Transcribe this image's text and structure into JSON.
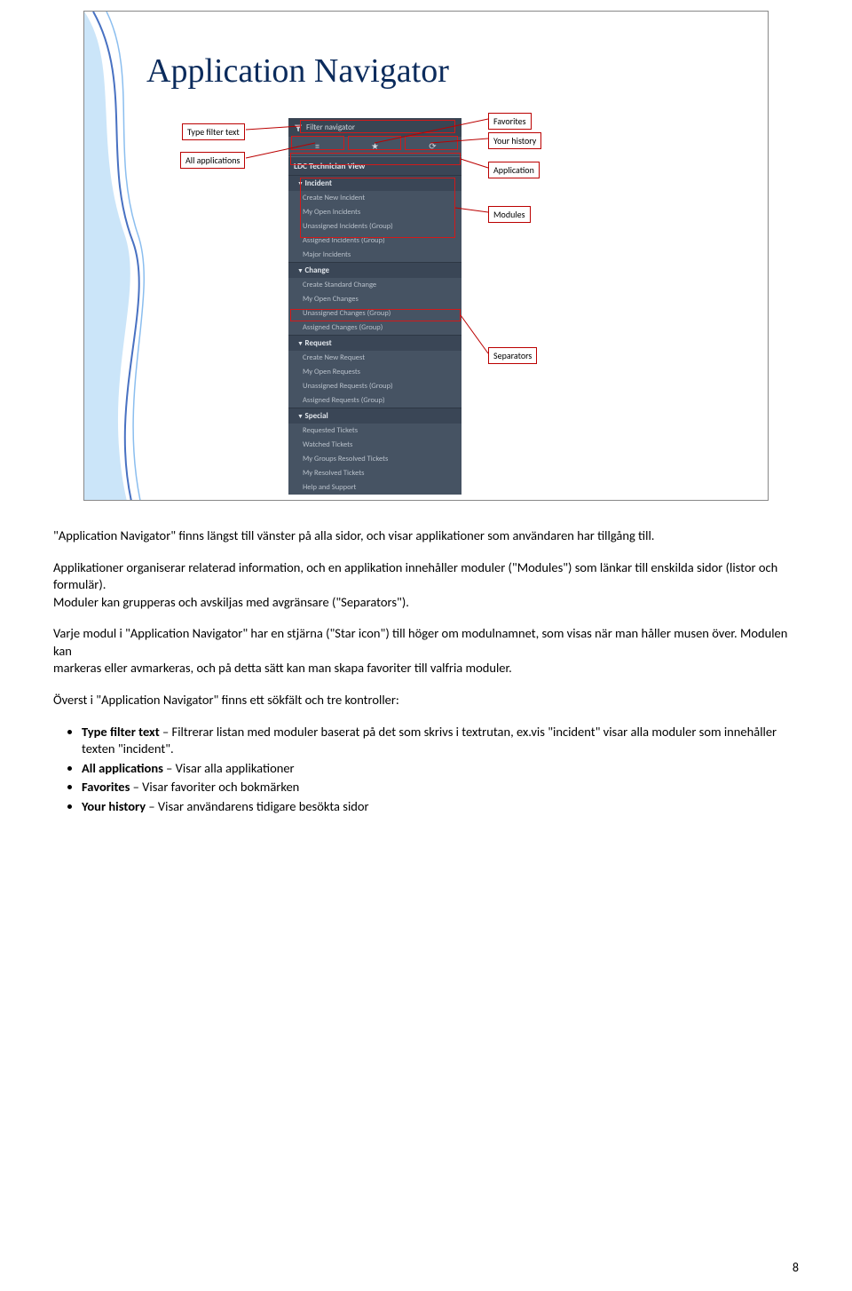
{
  "slide": {
    "title": "Application Navigator",
    "filterPlaceholder": "Filter navigator",
    "appHeader": "LDC Technician View",
    "sections": [
      {
        "name": "Incident",
        "modules": [
          "Create New Incident",
          "My Open Incidents",
          "Unassigned Incidents (Group)",
          "Assigned Incidents (Group)",
          "Major Incidents"
        ]
      },
      {
        "name": "Change",
        "modules": [
          "Create Standard Change",
          "My Open Changes",
          "Unassigned Changes (Group)",
          "Assigned Changes (Group)"
        ]
      },
      {
        "name": "Request",
        "modules": [
          "Create New Request",
          "My Open Requests",
          "Unassigned Requests (Group)",
          "Assigned Requests (Group)"
        ]
      },
      {
        "name": "Special",
        "modules": [
          "Requested Tickets",
          "Watched Tickets",
          "My Groups Resolved Tickets",
          "My Resolved Tickets",
          "Help and Support"
        ]
      }
    ],
    "callouts": {
      "typeFilter": "Type filter text",
      "allApps": "All applications",
      "favorites": "Favorites",
      "yourHistory": "Your history",
      "application": "Application",
      "modules": "Modules",
      "separators": "Separators"
    }
  },
  "body": {
    "p1": "\"Application Navigator\" finns längst till vänster på alla sidor, och visar applikationer som användaren har tillgång till.",
    "p2": "Applikationer organiserar relaterad information, och en applikation innehåller moduler (\"Modules\") som länkar till enskilda sidor (listor och formulär).",
    "p2b": "Moduler kan grupperas och avskiljas med avgränsare (\"Separators\").",
    "p3a": "Varje modul i \"Application Navigator\" har en stjärna (\"Star icon\") till höger om modulnamnet, som visas när man håller musen över. Modulen kan",
    "p3b": "markeras eller avmarkeras, och på detta sätt kan man skapa favoriter till valfria moduler.",
    "p4": "Överst i \"Application Navigator\" finns ett sökfält och tre kontroller:",
    "bullets": [
      {
        "bold": "Type filter text",
        "rest": " – Filtrerar listan med moduler baserat på det som skrivs i textrutan, ex.vis \"incident\" visar alla moduler som innehåller texten \"incident\"."
      },
      {
        "bold": "All applications",
        "rest": " – Visar alla applikationer"
      },
      {
        "bold": "Favorites",
        "rest": " – Visar favoriter och bokmärken"
      },
      {
        "bold": "Your history",
        "rest": " – Visar användarens tidigare besökta sidor"
      }
    ]
  },
  "pageNumber": "8"
}
